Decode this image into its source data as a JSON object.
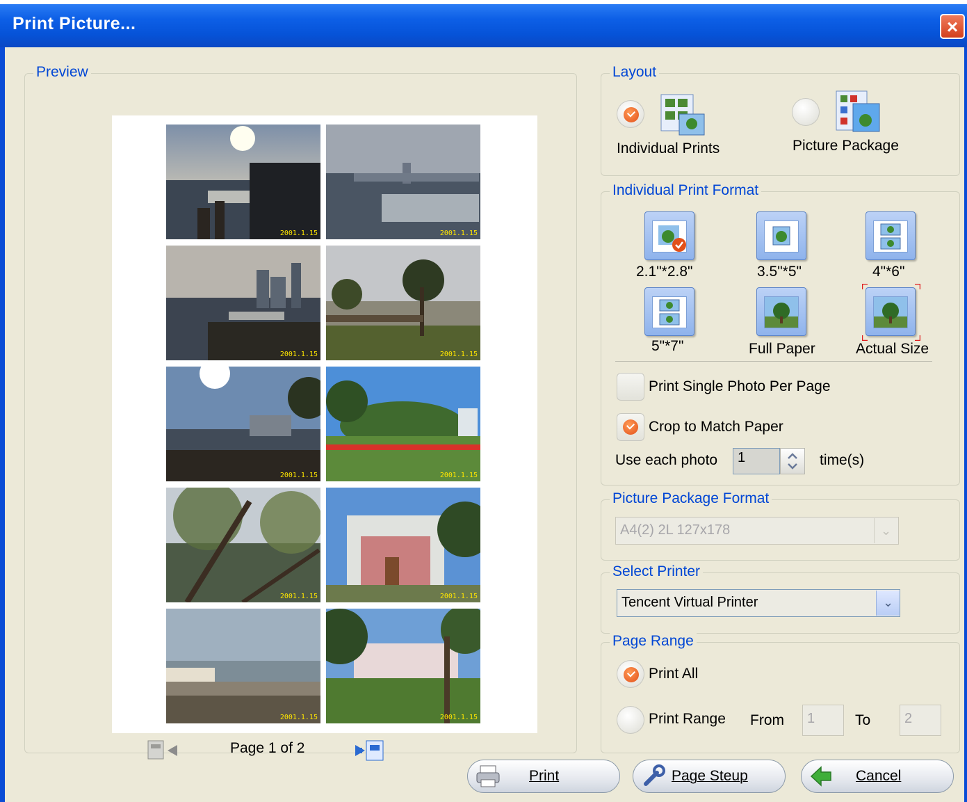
{
  "window": {
    "title": "Print Picture..."
  },
  "preview": {
    "legend": "Preview",
    "pager": "Page 1 of 2",
    "photo_stamps": [
      "2001.1.15",
      "2001.1.15",
      "2001.1.15",
      "2001.1.15",
      "2001.1.15",
      "2001.1.15",
      "2001.1.15",
      "2001.1.15",
      "2001.1.15",
      "2001.1.15"
    ]
  },
  "layout": {
    "legend": "Layout",
    "individual_prints": "Individual Prints",
    "picture_package": "Picture Package",
    "selected": "Individual Prints"
  },
  "individual_print_format": {
    "legend": "Individual Print Format",
    "formats": [
      "2.1\"*2.8\"",
      "3.5\"*5\"",
      "4\"*6\"",
      "5\"*7\"",
      "Full Paper",
      "Actual Size"
    ],
    "selected": "2.1\"*2.8\"",
    "print_single": "Print Single Photo Per Page",
    "print_single_checked": false,
    "crop_to_match": "Crop to Match Paper",
    "crop_checked": true,
    "use_each_label": "Use each photo",
    "use_each_value": "1",
    "times_label": "time(s)"
  },
  "picture_package_format": {
    "legend": "Picture Package Format",
    "value": "A4(2) 2L 127x178"
  },
  "select_printer": {
    "legend": "Select Printer",
    "value": "Tencent Virtual Printer"
  },
  "page_range": {
    "legend": "Page Range",
    "print_all": "Print All",
    "print_range": "Print Range",
    "from_label": "From",
    "to_label": "To",
    "from_value": "1",
    "to_value": "2",
    "selected": "Print All"
  },
  "buttons": {
    "print": "Print",
    "page_setup": "Page Steup",
    "cancel": "Cancel"
  },
  "colors": {
    "titlebar": "#0653d8",
    "legend_text": "#0046d5",
    "dialog_bg": "#ece9d8",
    "accent_orange": "#e2501a"
  }
}
